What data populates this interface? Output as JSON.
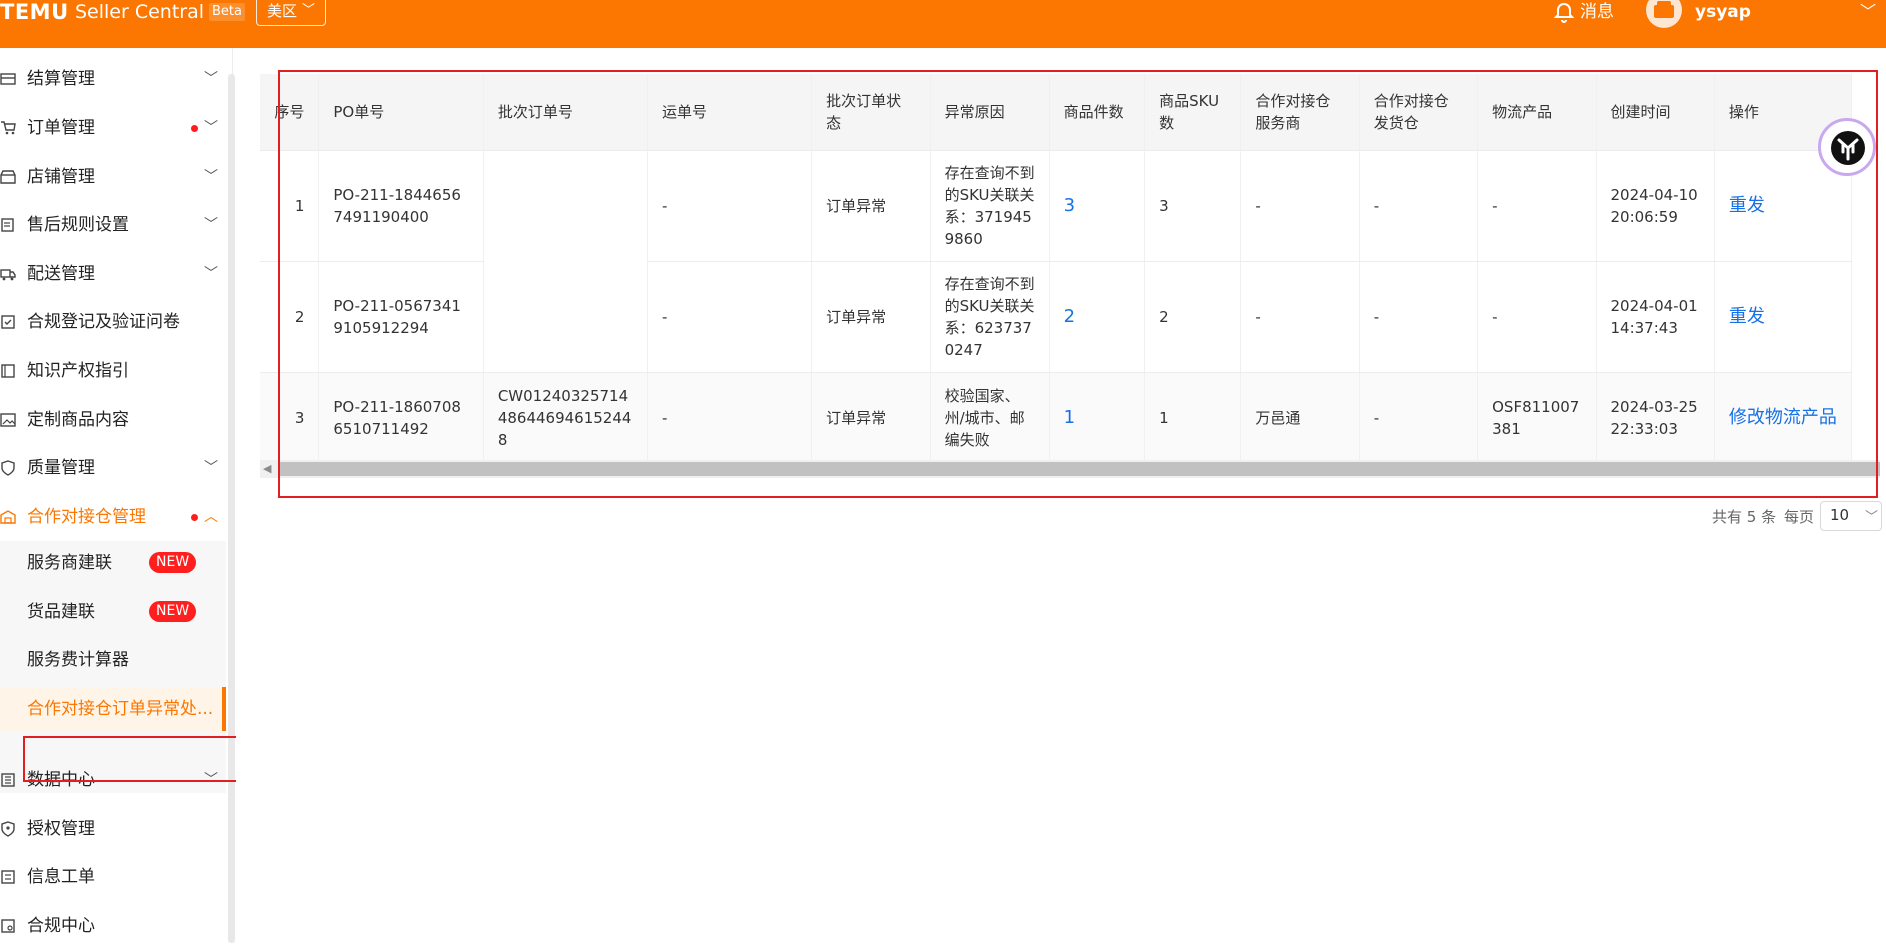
{
  "header": {
    "logo": "TEMU",
    "app_name": "Seller Central",
    "beta": "Beta",
    "region": "美区",
    "messages": "消息",
    "username": "ysyap"
  },
  "sidebar": {
    "items": [
      {
        "label": "结算管理",
        "icon": "wallet-icon",
        "chevron": "⌵"
      },
      {
        "label": "订单管理",
        "icon": "cart-icon",
        "chevron": "⌵",
        "dot": true
      },
      {
        "label": "店铺管理",
        "icon": "store-icon",
        "chevron": "⌵"
      },
      {
        "label": "售后规则设置",
        "icon": "after-sales-icon",
        "chevron": "⌵"
      },
      {
        "label": "配送管理",
        "icon": "truck-icon",
        "chevron": "⌵"
      },
      {
        "label": "合规登记及验证问卷",
        "icon": "compliance-form-icon"
      },
      {
        "label": "知识产权指引",
        "icon": "book-icon"
      },
      {
        "label": "定制商品内容",
        "icon": "image-icon"
      },
      {
        "label": "质量管理",
        "icon": "shield-check-icon",
        "chevron": "⌵"
      },
      {
        "label": "合作对接仓管理",
        "icon": "warehouse-icon",
        "chevron": "⌃",
        "dot": true,
        "active": true
      },
      {
        "label": "数据中心",
        "icon": "data-icon",
        "chevron": "⌵"
      },
      {
        "label": "授权管理",
        "icon": "authorization-icon"
      },
      {
        "label": "信息工单",
        "icon": "ticket-icon"
      },
      {
        "label": "合规中心",
        "icon": "compliance-center-icon"
      }
    ],
    "sub_items": [
      {
        "label": "服务商建联",
        "badge": "NEW"
      },
      {
        "label": "货品建联",
        "badge": "NEW"
      },
      {
        "label": "服务费计算器"
      },
      {
        "label": "合作对接仓订单异常处...",
        "selected": true
      }
    ]
  },
  "table": {
    "columns": [
      "序号",
      "PO单号",
      "批次订单号",
      "运单号",
      "批次订单状态",
      "异常原因",
      "商品件数",
      "商品SKU数",
      "合作对接仓服务商",
      "合作对接仓发货仓",
      "物流产品",
      "创建时间",
      "操作"
    ],
    "rows": [
      {
        "index": "1",
        "po": "PO-211-18446567491190400",
        "batch": "",
        "waybill": "-",
        "status": "订单异常",
        "reason": "存在查询不到的SKU关联关系：3719459860",
        "qty": "3",
        "sku": "3",
        "provider": "-",
        "warehouse": "-",
        "logistics": "-",
        "created": "2024-04-10 20:06:59",
        "action": "重发"
      },
      {
        "index": "2",
        "po": "PO-211-05673419105912294",
        "batch": "",
        "waybill": "-",
        "status": "订单异常",
        "reason": "存在查询不到的SKU关联关系：6237370247",
        "qty": "2",
        "sku": "2",
        "provider": "-",
        "warehouse": "-",
        "logistics": "-",
        "created": "2024-04-01 14:37:43",
        "action": "重发"
      },
      {
        "index": "3",
        "po": "PO-211-18607086510711492",
        "batch": "CW01240325714486446946152448",
        "waybill": "-",
        "status": "订单异常",
        "reason": "校验国家、州/城市、邮编失败",
        "qty": "1",
        "sku": "1",
        "provider": "万邑通",
        "warehouse": "-",
        "logistics": "OSF811007381",
        "created": "2024-03-25 22:33:03",
        "action": "修改物流产品"
      }
    ]
  },
  "pagination": {
    "total": "共有 5 条",
    "per_page_label": "每页",
    "per_page_value": "10"
  },
  "colors": {
    "brand_orange": "#fb7701",
    "link_blue": "#1771e6",
    "annotation_red": "#e02020",
    "badge_red": "#ff1f1f"
  }
}
